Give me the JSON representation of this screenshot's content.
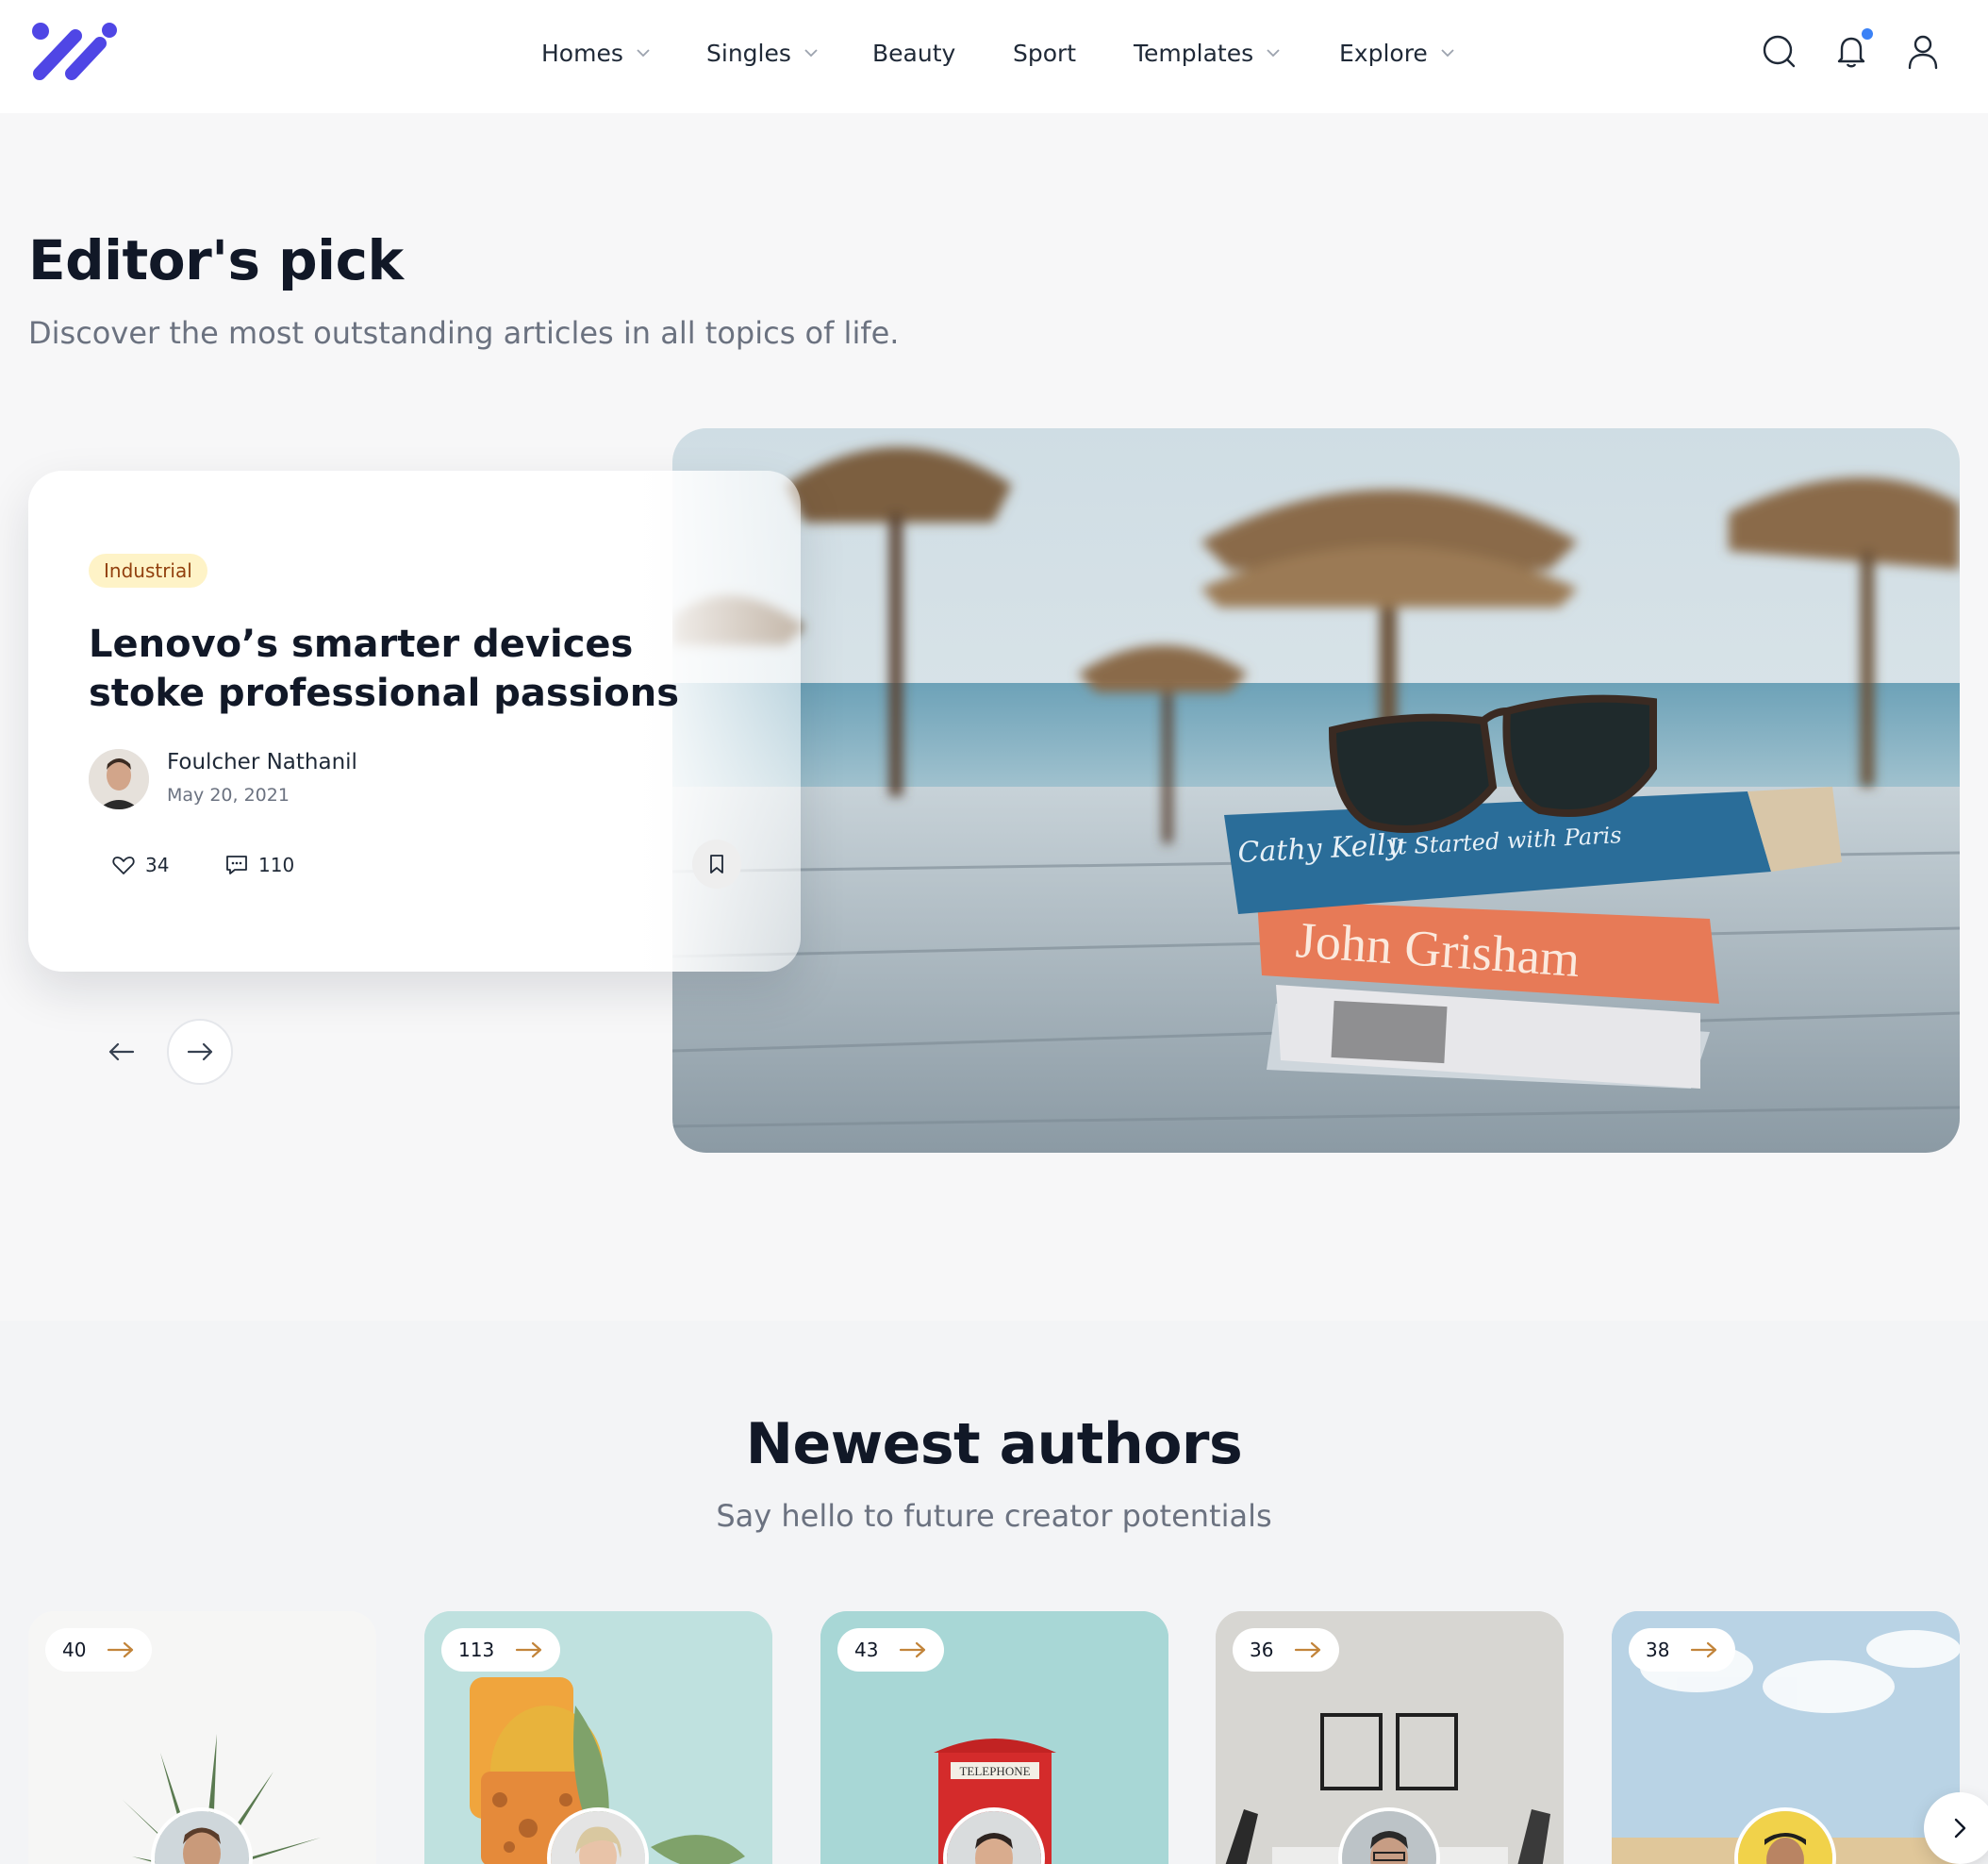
{
  "header": {
    "nav": [
      {
        "label": "Homes",
        "has_dropdown": true
      },
      {
        "label": "Singles",
        "has_dropdown": true
      },
      {
        "label": "Beauty",
        "has_dropdown": false
      },
      {
        "label": "Sport",
        "has_dropdown": false
      },
      {
        "label": "Templates",
        "has_dropdown": true
      },
      {
        "label": "Explore",
        "has_dropdown": true
      }
    ],
    "icons": [
      "search-icon",
      "bell-icon",
      "user-icon"
    ],
    "accent_color": "#4f46e5",
    "notification_dot_color": "#3b82f6"
  },
  "editors_pick": {
    "title": "Editor's pick",
    "subtitle": "Discover the most outstanding articles in all topics of life.",
    "featured": {
      "category": "Industrial",
      "title": "Lenovo’s smarter devices stoke professional passions",
      "author": "Foulcher Nathanil",
      "date": "May 20, 2021",
      "likes": "34",
      "comments": "110"
    },
    "image_book_texts": [
      "Cathy Kelly",
      "It Started with Paris",
      "John Grisham"
    ]
  },
  "newest_authors": {
    "title": "Newest authors",
    "subtitle": "Say hello to future creator potentials",
    "cards": [
      {
        "count": "40"
      },
      {
        "count": "113"
      },
      {
        "count": "43"
      },
      {
        "count": "36"
      },
      {
        "count": "38"
      }
    ],
    "telephone_sign": "TELEPHONE"
  }
}
